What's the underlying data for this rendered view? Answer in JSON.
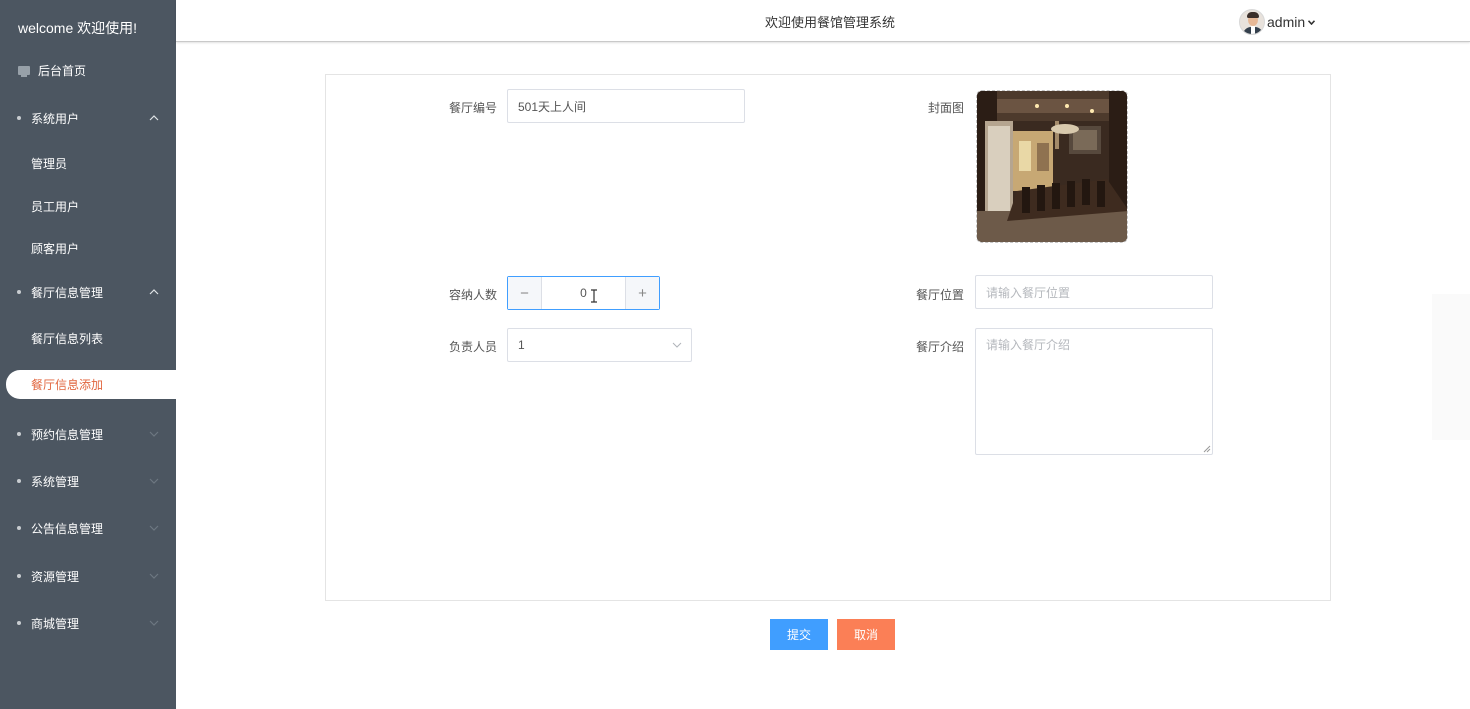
{
  "sidebar": {
    "welcome": "welcome 欢迎使用!",
    "home": "后台首页",
    "groups": [
      {
        "label": "系统用户",
        "expanded": true,
        "items": [
          "管理员",
          "员工用户",
          "顾客用户"
        ]
      },
      {
        "label": "餐厅信息管理",
        "expanded": true,
        "items": [
          "餐厅信息列表",
          "餐厅信息添加"
        ]
      },
      {
        "label": "预约信息管理",
        "expanded": false
      },
      {
        "label": "系统管理",
        "expanded": false
      },
      {
        "label": "公告信息管理",
        "expanded": false
      },
      {
        "label": "资源管理",
        "expanded": false
      },
      {
        "label": "商城管理",
        "expanded": false
      }
    ],
    "active_item": "餐厅信息添加"
  },
  "header": {
    "title": "欢迎使用餐馆管理系统",
    "user": "admin"
  },
  "form": {
    "restaurant_no_label": "餐厅编号",
    "restaurant_no_value": "501天上人间",
    "cover_label": "封面图",
    "capacity_label": "容纳人数",
    "capacity_value": "0",
    "location_label": "餐厅位置",
    "location_placeholder": "请输入餐厅位置",
    "manager_label": "负责人员",
    "manager_value": "1",
    "intro_label": "餐厅介绍",
    "intro_placeholder": "请输入餐厅介绍",
    "stepper_minus": "−",
    "stepper_plus": "+"
  },
  "actions": {
    "submit": "提交",
    "cancel": "取消"
  },
  "colors": {
    "sidebar_bg": "#4c5661",
    "active_text": "#e1663f",
    "primary": "#409eff",
    "cancel": "#fb7f56"
  }
}
